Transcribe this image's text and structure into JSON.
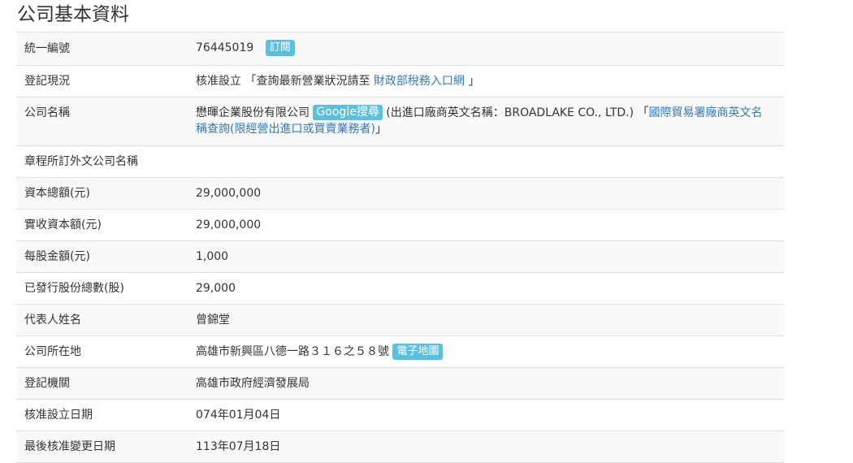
{
  "page": {
    "title": "公司基本資料"
  },
  "rows": {
    "ubn": {
      "label": "統一編號",
      "value": "76445019",
      "subscribe_label": "訂閱"
    },
    "reg_status": {
      "label": "登記現況",
      "status": "核准設立",
      "prefix": "「查詢最新營業狀況請至",
      "link_text": "財政部稅務入口網",
      "suffix": "」"
    },
    "company_name": {
      "label": "公司名稱",
      "name": "懋暉企業股份有限公司",
      "google_label": "Google搜尋",
      "english_name_text": "(出進口廠商英文名稱：BROADLAKE CO., LTD.)",
      "quote_open": "「",
      "link_text": "國際貿易署廠商英文名稱查詢(限經營出進口或買賣業務者)",
      "quote_close": "」"
    },
    "foreign_name": {
      "label": "章程所訂外文公司名稱",
      "value": ""
    },
    "total_capital": {
      "label": "資本總額(元)",
      "value": "29,000,000"
    },
    "paid_capital": {
      "label": "實收資本額(元)",
      "value": "29,000,000"
    },
    "par_value": {
      "label": "每股金額(元)",
      "value": "1,000"
    },
    "shares_issued": {
      "label": "已發行股份總數(股)",
      "value": "29,000"
    },
    "representative": {
      "label": "代表人姓名",
      "value": "曾錦堂"
    },
    "address": {
      "label": "公司所在地",
      "value": "高雄市新興區八德一路３１６之５８號",
      "map_label": "電子地圖"
    },
    "authority": {
      "label": "登記機關",
      "value": "高雄市政府經濟發展局"
    },
    "approval_date": {
      "label": "核准設立日期",
      "value": "074年01月04日"
    },
    "last_change_date": {
      "label": "最後核准變更日期",
      "value": "113年07月18日"
    }
  },
  "colors": {
    "badge": "#5bc0de",
    "link": "#337ab7",
    "stripe": "#f9f9f9",
    "border": "#dddddd"
  }
}
